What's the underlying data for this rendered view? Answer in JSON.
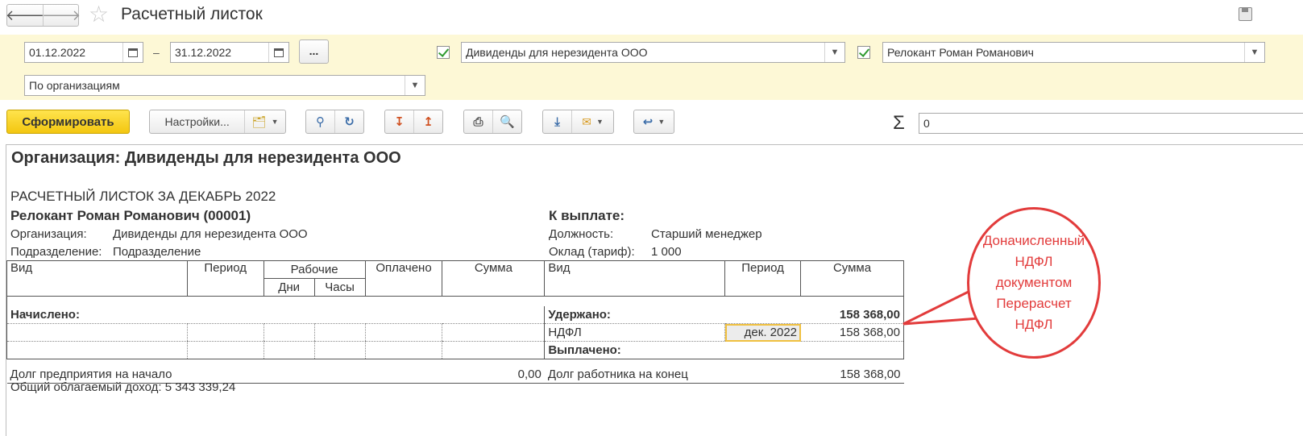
{
  "window": {
    "title": "Расчетный листок",
    "back_icon": "arrow-left-icon",
    "forward_icon": "arrow-right-icon",
    "favorite_icon": "star-icon"
  },
  "filters": {
    "date_from": "01.12.2022",
    "date_sep": "–",
    "date_to": "31.12.2022",
    "more_label": "...",
    "organization_checked": true,
    "organization": "Дивиденды для нерезидента ООО",
    "employee_checked": true,
    "employee": "Релокант Роман Романович",
    "grouping": "По организациям"
  },
  "toolbar": {
    "generate_label": "Сформировать",
    "settings_label": "Настройки...",
    "sum_symbol": "Σ",
    "sum_value": "0"
  },
  "report": {
    "org_title": "Организация: Дивиденды для нерезидента ООО",
    "heading": "РАСЧЕТНЫЙ ЛИСТОК ЗА ДЕКАБРЬ 2022",
    "employee_line": "Релокант Роман Романович (00001)",
    "to_pay_label": "К выплате:",
    "org_label": "Организация:",
    "org_value": "Дивиденды для нерезидента ООО",
    "dept_label": "Подразделение:",
    "dept_value": "Подразделение",
    "position_label": "Должность:",
    "position_value": "Старший менеджер",
    "salary_label": "Оклад (тариф):",
    "salary_value": "1 000",
    "left_headers": {
      "kind": "Вид",
      "period": "Период",
      "work": "Рабочие",
      "days": "Дни",
      "hours": "Часы",
      "paid": "Оплачено",
      "sum": "Сумма"
    },
    "right_headers": {
      "kind": "Вид",
      "period": "Период",
      "sum": "Сумма"
    },
    "accrued_label": "Начислено:",
    "withheld_label": "Удержано:",
    "withheld_total": "158 368,00",
    "ndfl_label": "НДФЛ",
    "ndfl_period": "дек. 2022",
    "ndfl_sum": "158 368,00",
    "paid_out_label": "Выплачено:",
    "debt_start_label": "Долг предприятия на начало",
    "debt_start_value": "0,00",
    "debt_end_label": "Долг работника на конец",
    "debt_end_value": "158 368,00",
    "taxable_income": "Общий облагаемый доход: 5 343 339,24"
  },
  "callout": {
    "lines": [
      "Доначисленный",
      "НДФЛ",
      "документом",
      "Перерасчет",
      "НДФЛ"
    ],
    "color": "#e23b3b"
  }
}
